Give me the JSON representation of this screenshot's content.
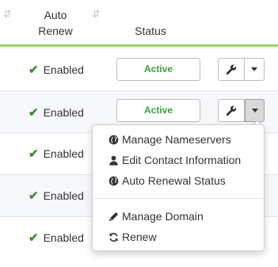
{
  "header": {
    "auto_renew_line1": "Auto",
    "auto_renew_line2": "Renew",
    "status": "Status"
  },
  "colors": {
    "accent_underline": "#9bd06b",
    "enabled_check": "#3d8b3d",
    "active_text": "#39a03a"
  },
  "rows": [
    {
      "auto_renew": "Enabled",
      "status": "Active"
    },
    {
      "auto_renew": "Enabled",
      "status": "Active"
    },
    {
      "auto_renew": "Enabled"
    },
    {
      "auto_renew": "Enabled"
    },
    {
      "auto_renew": "Enabled"
    }
  ],
  "dropdown": {
    "items": [
      {
        "label": "Manage Nameservers",
        "icon": "globe-icon"
      },
      {
        "label": "Edit Contact Information",
        "icon": "user-icon"
      },
      {
        "label": "Auto Renewal Status",
        "icon": "globe-icon"
      },
      {
        "label": "Manage Domain",
        "icon": "pencil-icon"
      },
      {
        "label": "Renew",
        "icon": "refresh-icon"
      }
    ]
  }
}
